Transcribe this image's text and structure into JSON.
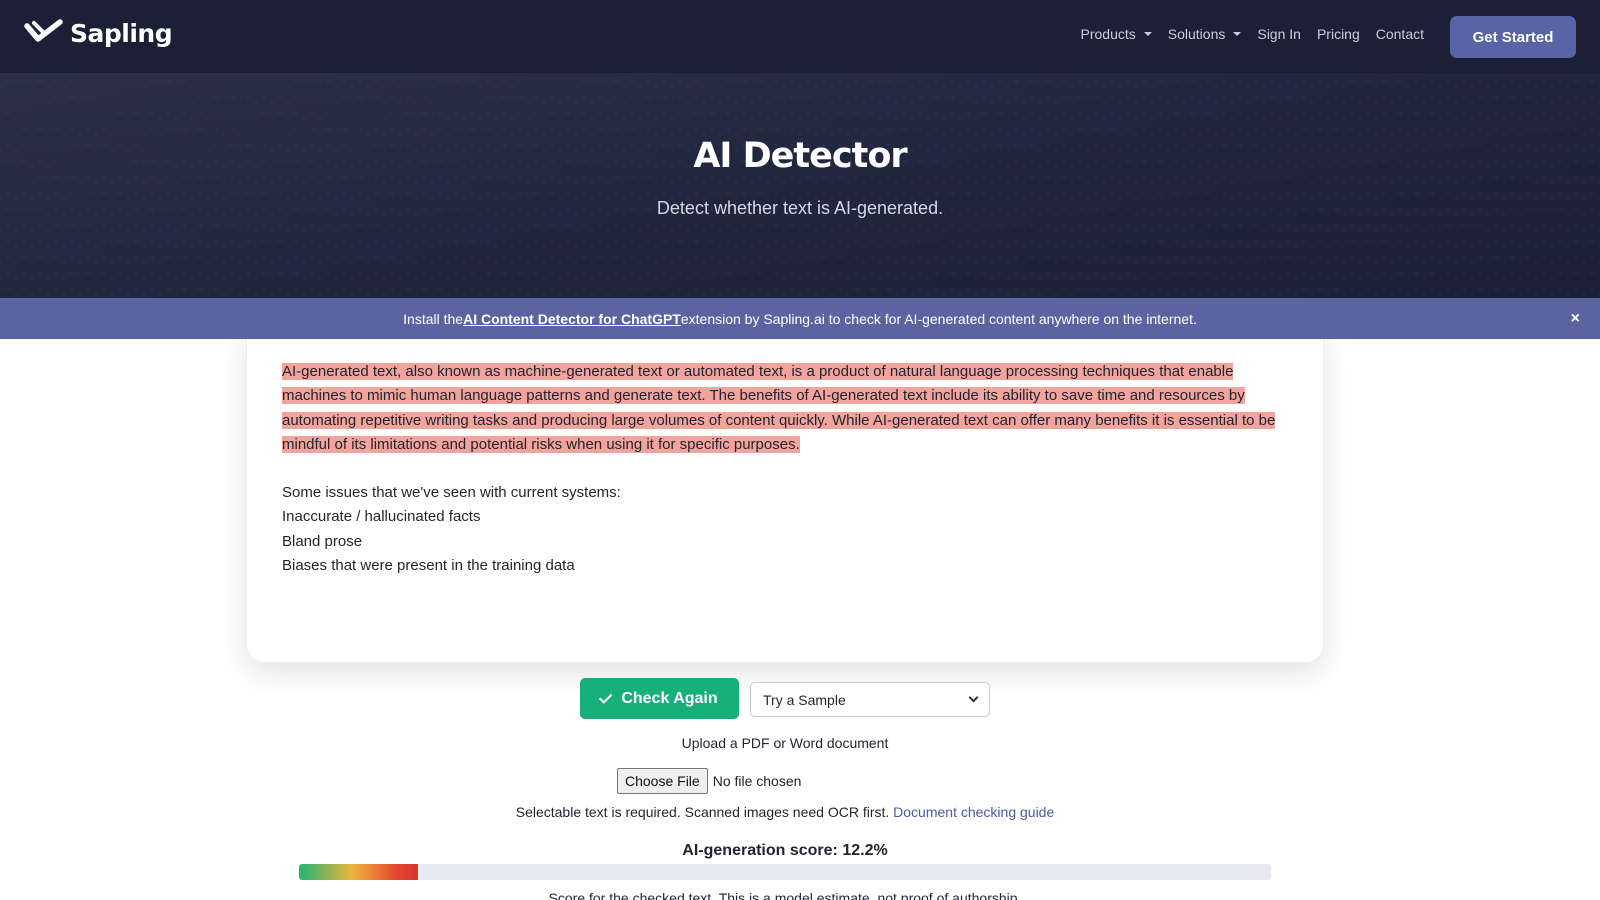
{
  "nav": {
    "brand": "Sapling",
    "links": [
      {
        "label": "Products",
        "dropdown": true
      },
      {
        "label": "Solutions",
        "dropdown": true
      },
      {
        "label": "Sign In",
        "dropdown": false
      },
      {
        "label": "Pricing",
        "dropdown": false
      },
      {
        "label": "Contact",
        "dropdown": false
      }
    ],
    "cta_label": "Get Started"
  },
  "hero": {
    "title": "AI Detector",
    "subtitle": "Detect whether text is AI-generated."
  },
  "banner": {
    "prefix": "Install the ",
    "link_text": "AI Content Detector for ChatGPT ",
    "suffix": " extension by Sapling.ai to check for AI-generated content anywhere on the internet.",
    "close_label": "×"
  },
  "editor": {
    "highlighted_paragraph": "AI-generated text, also known as machine-generated text or automated text, is a product of natural language processing techniques that enable machines to mimic human language patterns and generate text. The benefits of AI-generated text include its ability to save time and resources by automating repetitive writing tasks and producing large volumes of content quickly. While AI-generated text can offer many benefits it is essential to be mindful of its limitations and potential risks when using it for specific purposes.",
    "lines": [
      "Some issues that we've seen with current systems:",
      "Inaccurate / hallucinated facts",
      "Bland prose",
      "Biases that were present in the training data"
    ],
    "highlight_color": "#f2a39c"
  },
  "controls": {
    "check_label": "Check Again",
    "sample_selected": "Try a Sample"
  },
  "upload": {
    "label": "Upload a PDF or Word document",
    "button_label": "Choose File",
    "status": "No file chosen",
    "note": "Selectable text is required. Scanned images need OCR first. ",
    "guide_link": "Document checking guide"
  },
  "score": {
    "label": "AI-generation score: 12.2%",
    "value": 0.122,
    "note": "Score for the checked text. This is a model estimate, not proof of authorship."
  }
}
